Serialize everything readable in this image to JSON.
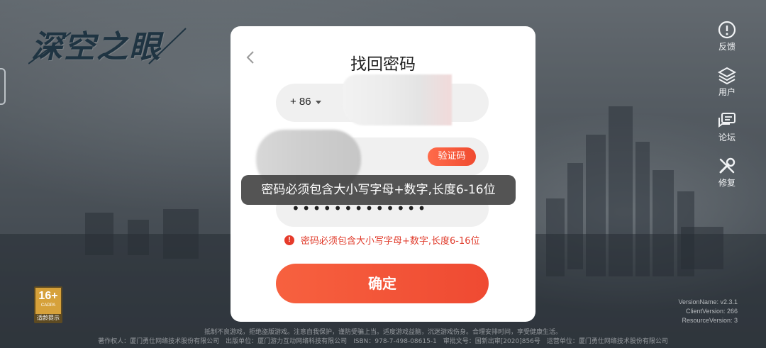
{
  "app": {
    "logo_text": "深空之眼",
    "age_badge": {
      "rating": "16+",
      "org": "CADPA",
      "tip": "适龄提示"
    }
  },
  "side_menu": [
    {
      "label": "反馈",
      "icon": "alert-circle-icon"
    },
    {
      "label": "用户",
      "icon": "layers-icon"
    },
    {
      "label": "论坛",
      "icon": "chat-icon"
    },
    {
      "label": "修复",
      "icon": "wrench-icon"
    }
  ],
  "version": {
    "line1": "VersionName: v2.3.1",
    "line2": "ClientVersion: 266",
    "line3": "ResourceVersion: 3"
  },
  "footer": {
    "line1": "抵制不良游戏，拒绝盗版游戏。注意自我保护，谨防受骗上当。适度游戏益脑，沉迷游戏伤身。合理安排时间，享受健康生活。",
    "line2": "著作权人：厦门勇仕网络技术股份有限公司　出版单位：厦门游力互动网络科技有限公司　ISBN：978-7-498-08615-1　审批文号：国新出审[2020]856号　运营单位：厦门勇仕网络技术股份有限公司"
  },
  "dialog": {
    "title": "找回密码",
    "country_code": "+ 86",
    "verify_button": "验证码",
    "password_mask": "•••••••••••••",
    "error_text": "密码必须包含大小写字母+数字,长度6-16位",
    "confirm_button": "确定"
  },
  "toast": {
    "text": "密码必须包含大小写字母+数字,长度6-16位"
  },
  "colors": {
    "accent": "#f04b30",
    "error": "#e03a2a",
    "dialog_bg": "#ffffff",
    "field_bg": "#f0f0f0"
  }
}
